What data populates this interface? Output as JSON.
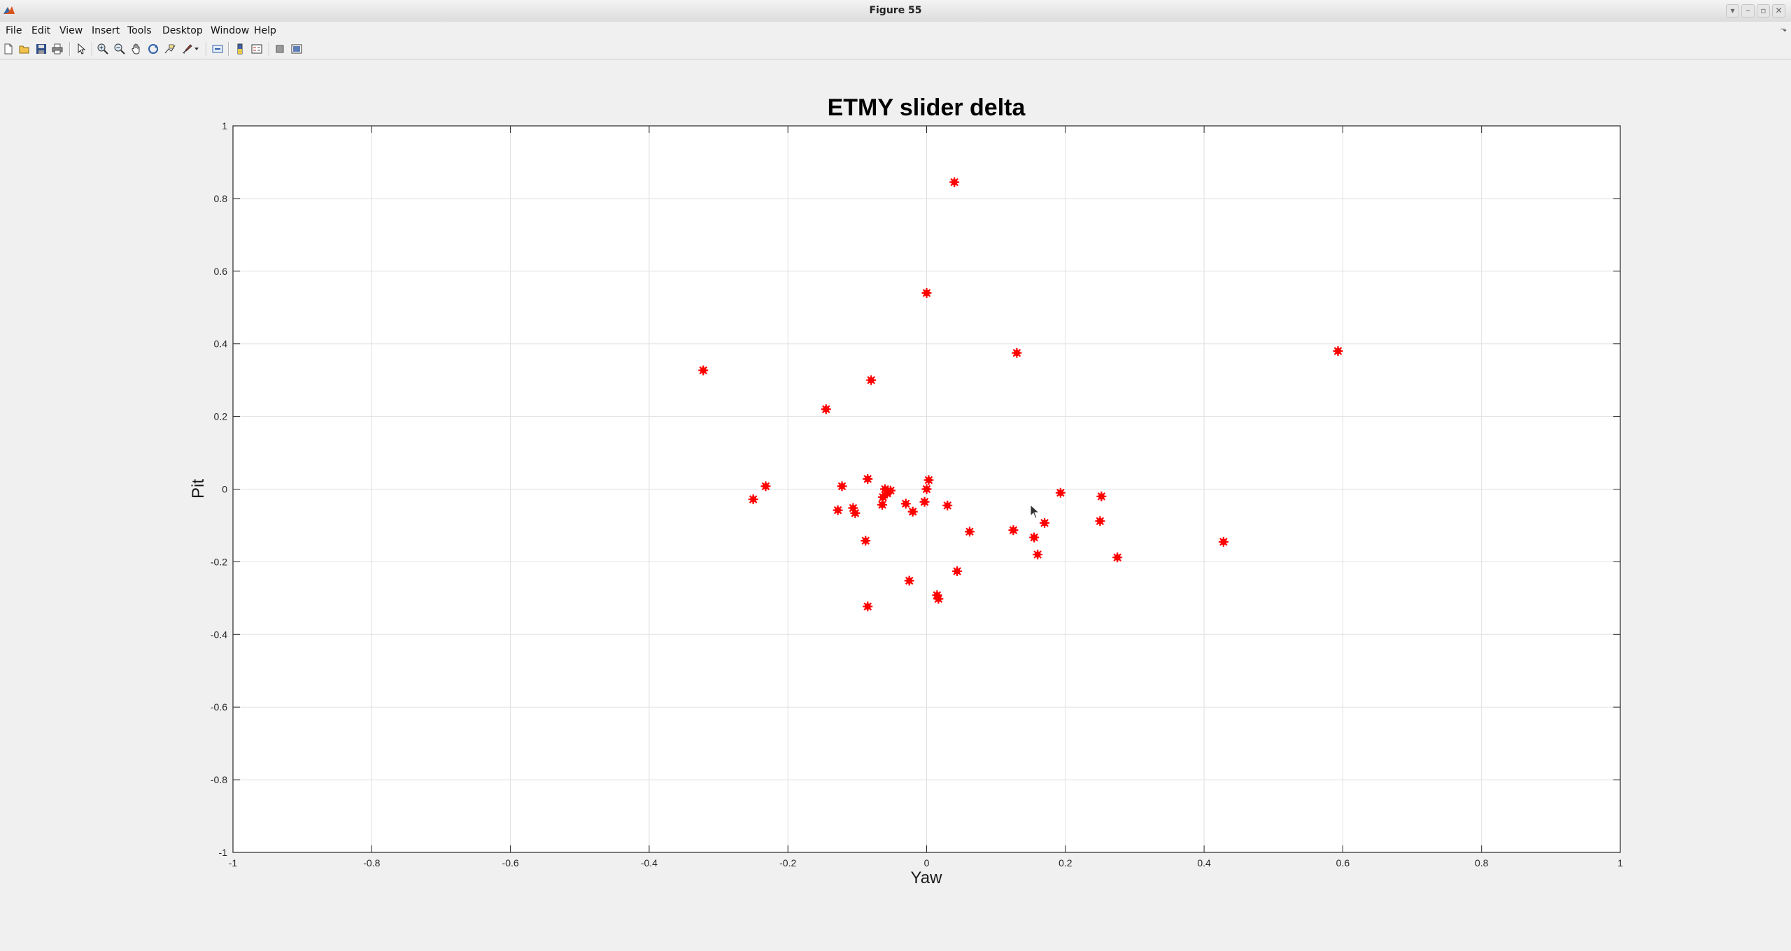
{
  "window": {
    "title": "Figure 55",
    "controls": [
      "▾",
      "–",
      "▫",
      "✕"
    ]
  },
  "menubar": {
    "items": [
      "File",
      "Edit",
      "View",
      "Insert",
      "Tools",
      "Desktop",
      "Window",
      "Help"
    ],
    "overflow_arrow": "⬎"
  },
  "toolbar": {
    "icons": [
      "new-figure-icon",
      "open-file-icon",
      "save-icon",
      "print-icon",
      "pointer-icon",
      "zoom-in-icon",
      "zoom-out-icon",
      "pan-icon",
      "rotate-3d-icon",
      "data-cursor-icon",
      "brush-icon",
      "link-plot-icon",
      "colorbar-icon",
      "legend-icon",
      "hide-plot-tools-icon",
      "show-plot-tools-icon"
    ]
  },
  "chart_data": {
    "type": "scatter",
    "title": "ETMY slider delta",
    "xlabel": "Yaw",
    "ylabel": "Pit",
    "xlim": [
      -1,
      1
    ],
    "ylim": [
      -1,
      1
    ],
    "xticks": [
      "-1",
      "-0.8",
      "-0.6",
      "-0.4",
      "-0.2",
      "0",
      "0.2",
      "0.4",
      "0.6",
      "0.8",
      "1"
    ],
    "yticks": [
      "1",
      "0.8",
      "0.6",
      "0.4",
      "0.2",
      "0",
      "-0.2",
      "-0.4",
      "-0.6",
      "-0.8",
      "-1"
    ],
    "grid": true,
    "marker_color": "#ff0000",
    "marker": "asterisk",
    "points": [
      {
        "x": 0.04,
        "y": 0.845
      },
      {
        "x": 0.0,
        "y": 0.54
      },
      {
        "x": 0.13,
        "y": 0.375
      },
      {
        "x": 0.593,
        "y": 0.38
      },
      {
        "x": -0.322,
        "y": 0.327
      },
      {
        "x": -0.08,
        "y": 0.3
      },
      {
        "x": -0.145,
        "y": 0.22
      },
      {
        "x": -0.232,
        "y": 0.008
      },
      {
        "x": -0.25,
        "y": -0.028
      },
      {
        "x": -0.122,
        "y": 0.008
      },
      {
        "x": -0.128,
        "y": -0.058
      },
      {
        "x": -0.106,
        "y": -0.052
      },
      {
        "x": -0.103,
        "y": -0.066
      },
      {
        "x": -0.085,
        "y": 0.028
      },
      {
        "x": -0.088,
        "y": -0.142
      },
      {
        "x": -0.085,
        "y": -0.323
      },
      {
        "x": -0.064,
        "y": -0.043
      },
      {
        "x": -0.063,
        "y": -0.022
      },
      {
        "x": -0.06,
        "y": 0.0
      },
      {
        "x": -0.057,
        "y": -0.012
      },
      {
        "x": -0.052,
        "y": -0.004
      },
      {
        "x": -0.03,
        "y": -0.04
      },
      {
        "x": -0.02,
        "y": -0.062
      },
      {
        "x": -0.025,
        "y": -0.252
      },
      {
        "x": -0.003,
        "y": -0.035
      },
      {
        "x": 0.0,
        "y": 0.0
      },
      {
        "x": 0.003,
        "y": 0.025
      },
      {
        "x": 0.015,
        "y": -0.292
      },
      {
        "x": 0.017,
        "y": -0.302
      },
      {
        "x": 0.03,
        "y": -0.045
      },
      {
        "x": 0.044,
        "y": -0.226
      },
      {
        "x": 0.062,
        "y": -0.117
      },
      {
        "x": 0.125,
        "y": -0.113
      },
      {
        "x": 0.155,
        "y": -0.133
      },
      {
        "x": 0.16,
        "y": -0.18
      },
      {
        "x": 0.17,
        "y": -0.093
      },
      {
        "x": 0.193,
        "y": -0.01
      },
      {
        "x": 0.25,
        "y": -0.088
      },
      {
        "x": 0.252,
        "y": -0.02
      },
      {
        "x": 0.275,
        "y": -0.188
      },
      {
        "x": 0.428,
        "y": -0.145
      }
    ]
  }
}
